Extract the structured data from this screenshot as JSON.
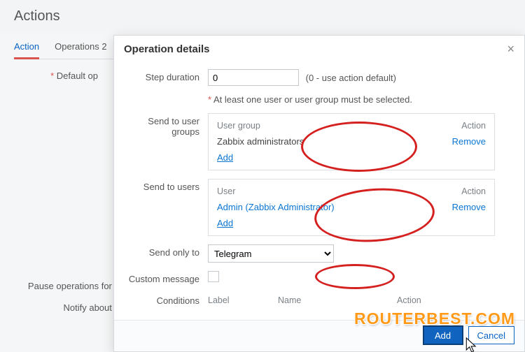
{
  "page": {
    "title": "Actions"
  },
  "tabs": {
    "action": "Action",
    "operations": "Operations 2"
  },
  "bg": {
    "default_op_label": "Default op",
    "pause_label": "Pause operations for s",
    "notify_label": "Notify about c"
  },
  "dialog": {
    "title": "Operation details",
    "close": "×",
    "step_duration_label": "Step duration",
    "step_duration_value": "0",
    "step_duration_hint": "(0 - use action default)",
    "required_msg": "At least one user or user group must be selected.",
    "groups_label": "Send to user groups",
    "group_header": "User group",
    "action_header": "Action",
    "group_row": "Zabbix administrators",
    "remove": "Remove",
    "add": "Add",
    "users_label": "Send to users",
    "user_header": "User",
    "user_row": "Admin (Zabbix Administrator)",
    "send_only_to_label": "Send only to",
    "send_only_to_value": "Telegram",
    "custom_message_label": "Custom message",
    "conditions_label": "Conditions",
    "cond_label": "Label",
    "cond_name": "Name",
    "cond_action": "Action",
    "btn_add": "Add",
    "btn_cancel": "Cancel"
  },
  "watermark": "ROUTERBEST.COM"
}
